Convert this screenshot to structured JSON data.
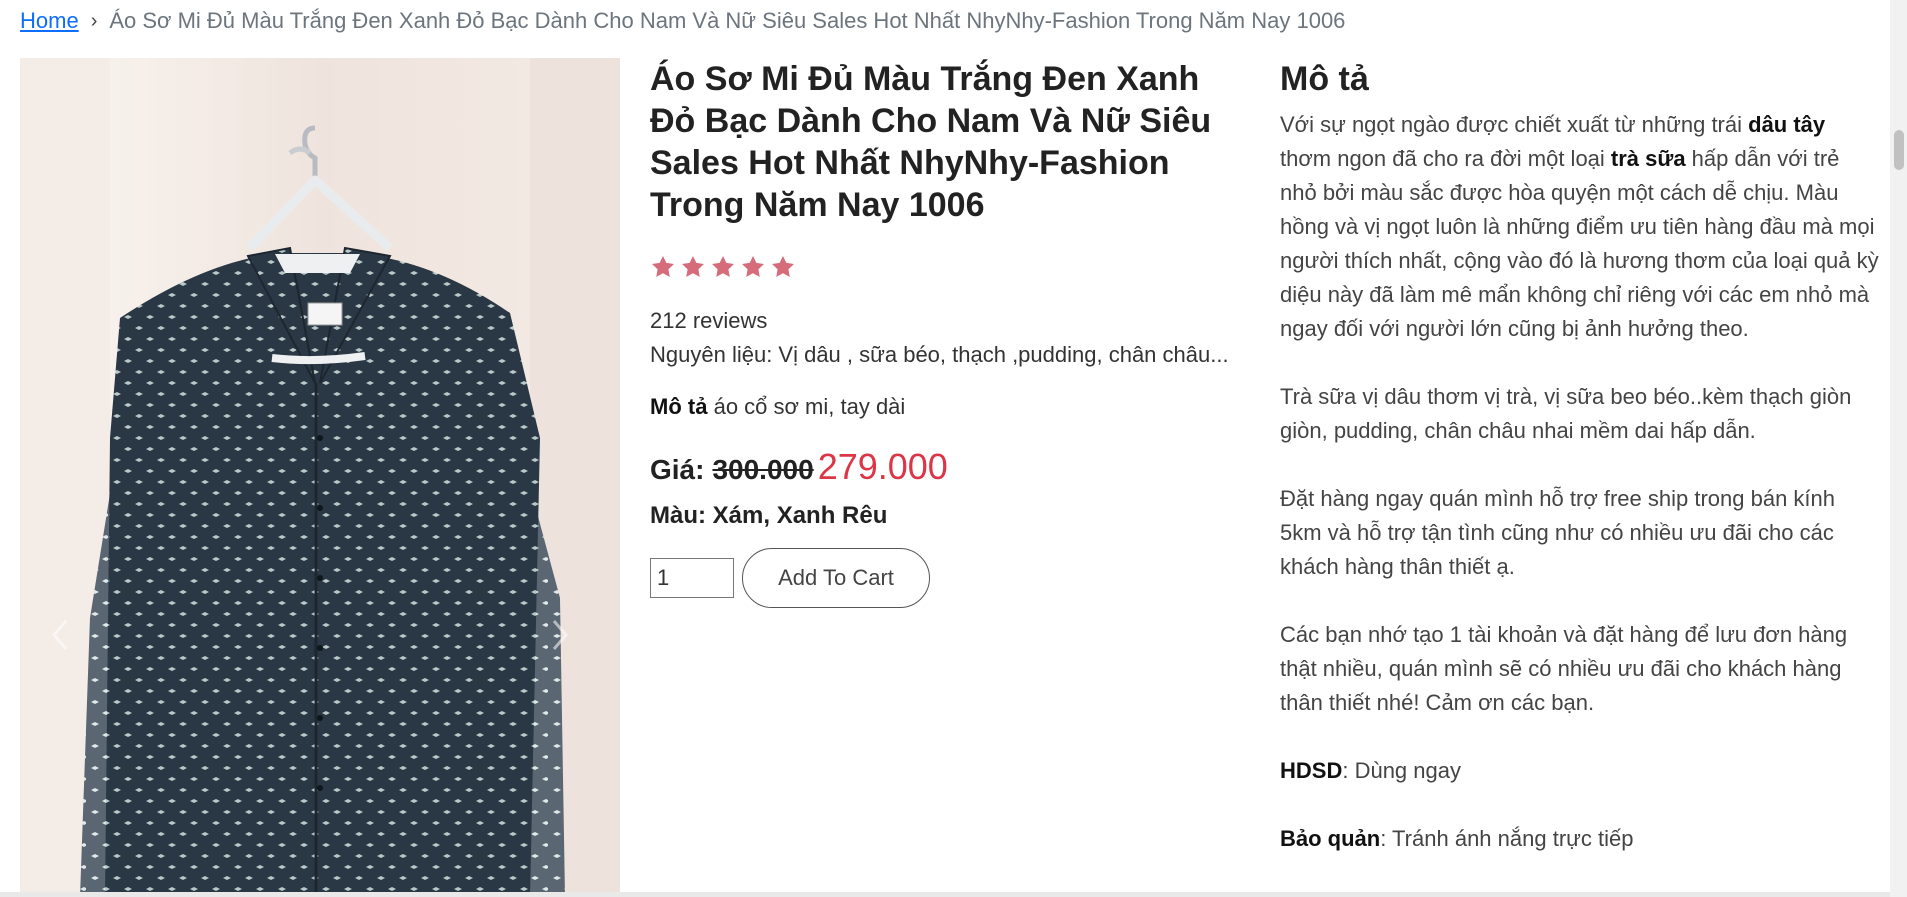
{
  "breadcrumb": {
    "home": "Home",
    "separator": "›",
    "current": "Áo Sơ Mi Đủ Màu Trắng Đen Xanh Đỏ Bạc Dành Cho Nam Và Nữ Siêu Sales Hot Nhất NhyNhy-Fashion Trong Năm Nay 1006"
  },
  "product": {
    "title": "Áo Sơ Mi Đủ Màu Trắng Đen Xanh Đỏ Bạc Dành Cho Nam Và Nữ Siêu Sales Hot Nhất NhyNhy-Fashion Trong Năm Nay 1006",
    "rating": 5,
    "star_color": "#d66b79",
    "reviews": "212 reviews",
    "ingredients": "Nguyên liệu: Vị dâu , sữa béo, thạch ,pudding, chân châu...",
    "short_desc_label": "Mô tả",
    "short_desc": "áo cổ sơ mi, tay dài",
    "price_label": "Giá:",
    "price_old": "300.000",
    "price_new": "279.000",
    "color_text": "Màu: Xám, Xanh Rêu",
    "quantity": "1",
    "add_to_cart": "Add To Cart"
  },
  "description": {
    "heading": "Mô tả",
    "p1_a": "Với sự ngọt ngào được chiết xuất từ những trái ",
    "p1_b": "dâu tây",
    "p1_c": " thơm ngon đã cho ra đời một loại ",
    "p1_d": "trà sữa",
    "p1_e": " hấp dẫn với trẻ nhỏ bởi màu sắc được hòa quyện một cách dễ chịu. Màu hồng và vị ngọt luôn là những điểm ưu tiên hàng đầu mà mọi người thích nhất, cộng vào đó là hương thơm của loại quả kỳ diệu này đã làm mê mẩn không chỉ riêng với các em nhỏ mà ngay đối với người lớn cũng bị ảnh hưởng theo.",
    "p2": "Trà sữa vị dâu thơm vị trà, vị sữa beo béo..kèm thạch giòn giòn, pudding, chân châu nhai mềm dai hấp dẫn.",
    "p3": "Đặt hàng ngay quán mình hỗ trợ free ship trong bán kính 5km và hỗ trợ tận tình cũng như có nhiều ưu đãi cho các khách hàng thân thiết ạ.",
    "p4": "Các bạn nhớ tạo 1 tài khoản và đặt hàng để lưu đơn hàng thật nhiều, quán mình sẽ có nhiều ưu đãi cho khách hàng thân thiết nhé! Cảm ơn các bạn.",
    "hdsd_label": "HDSD",
    "hdsd_text": ": Dùng ngay",
    "baoquan_label": "Bảo quản",
    "baoquan_text": ": Tránh ánh nắng trực tiếp"
  },
  "colors": {
    "link": "#0d6efd",
    "price_new": "#dc3545",
    "shirt": "#2a3744"
  }
}
